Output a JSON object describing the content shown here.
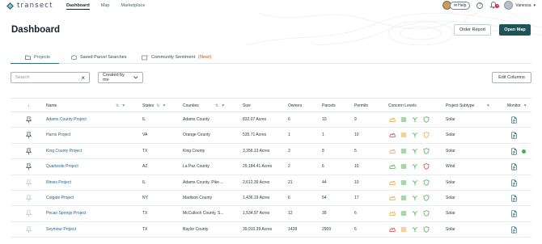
{
  "brand": {
    "name": "transect"
  },
  "nav": {
    "items": [
      {
        "label": "Dashboard",
        "active": true
      },
      {
        "label": "Map",
        "active": false
      },
      {
        "label": "Marketplace",
        "active": false
      }
    ]
  },
  "topbar": {
    "help_label": "Help",
    "notification_count": "9",
    "user_name": "Vanessa"
  },
  "header": {
    "title": "Dashboard",
    "order_report_label": "Order Report",
    "open_map_label": "Open Map"
  },
  "tabs": [
    {
      "label": "Projects",
      "active": true
    },
    {
      "label": "Saved Parcel Searches",
      "active": false
    },
    {
      "label": "Community Sentiment",
      "badge": "(New!)",
      "active": false
    }
  ],
  "filters": {
    "search_placeholder": "Search",
    "search_value": "",
    "created_by": "Created by me",
    "edit_columns_label": "Edit Columns"
  },
  "table": {
    "headers": {
      "sort": "↓",
      "name": "Name",
      "states": "States",
      "counties": "Counties",
      "size": "Size",
      "owners": "Owners",
      "parcels": "Parcels",
      "permits": "Permits",
      "concerns": "Concern Levels",
      "subtype": "Project Subtype",
      "monitor": "Monitor"
    },
    "rows": [
      {
        "name": "Adams County Project",
        "state": "IL",
        "county": "Adams County",
        "size": "832.07 Acres",
        "owners": "6",
        "parcels": "10",
        "permits": "9",
        "subtype": "Solar",
        "pinned": true,
        "monitored": false,
        "concerns": [
          "#e8a33d",
          "#4caf50",
          "#4caf50",
          "#4caf50"
        ]
      },
      {
        "name": "Harris Project",
        "state": "VA",
        "county": "Orange County",
        "size": "535.71 Acres",
        "owners": "1",
        "parcels": "1",
        "permits": "10",
        "subtype": "Solar",
        "pinned": true,
        "monitored": false,
        "concerns": [
          "#e2403a",
          "#e8a33d",
          "#4caf50",
          "#e8a33d"
        ]
      },
      {
        "name": "King County Project",
        "state": "TX",
        "county": "King County",
        "size": "3,356.13 Acres",
        "owners": "3",
        "parcels": "8",
        "permits": "5",
        "subtype": "Solar",
        "pinned": true,
        "monitored": true,
        "concerns": [
          "#e8a33d",
          "#4caf50",
          "#4caf50",
          "#4caf50"
        ]
      },
      {
        "name": "Quartzsite Project",
        "state": "AZ",
        "county": "La Paz County",
        "size": "29,184.41 Acres",
        "owners": "2",
        "parcels": "6",
        "permits": "10",
        "subtype": "Wind",
        "pinned": true,
        "monitored": false,
        "concerns": [
          "#4caf50",
          "#4caf50",
          "#4caf50",
          "#e2403a"
        ]
      },
      {
        "name": "Illinois Project",
        "state": "IL",
        "county": "Adams County, Pike ...",
        "size": "2,612.39 Acres",
        "owners": "21",
        "parcels": "44",
        "permits": "10",
        "subtype": "Solar",
        "pinned": false,
        "monitored": false,
        "concerns": [
          "#e8a33d",
          "#4caf50",
          "#4caf50",
          "#4caf50"
        ]
      },
      {
        "name": "Colgate Project",
        "state": "NY",
        "county": "Madison County",
        "size": "1,436.19 Acres",
        "owners": "6",
        "parcels": "54",
        "permits": "17",
        "subtype": "Solar",
        "pinned": false,
        "monitored": false,
        "concerns": [
          "#e8a33d",
          "#4caf50",
          "#4caf50",
          "#4caf50"
        ]
      },
      {
        "name": "Pecan Springs Project",
        "state": "TX",
        "county": "McCulloch County, S...",
        "size": "1,534.97 Acres",
        "owners": "12",
        "parcels": "39",
        "permits": "6",
        "subtype": "Solar",
        "pinned": false,
        "monitored": false,
        "concerns": [
          "#e8a33d",
          "#4caf50",
          "#4caf50",
          "#4caf50"
        ]
      },
      {
        "name": "Seymour Project",
        "state": "TX",
        "county": "Baylor County",
        "size": "39,910.39 Acres",
        "owners": "1428",
        "parcels": "2909",
        "permits": "6",
        "subtype": "Solar",
        "pinned": false,
        "monitored": false,
        "concerns": [
          "#e2403a",
          "#e8a33d",
          "#4caf50",
          "#4caf50"
        ]
      }
    ]
  },
  "colors": {
    "accent": "#1f5457",
    "link": "#1f5f8b",
    "monitor_dot": "#3ab54a"
  }
}
